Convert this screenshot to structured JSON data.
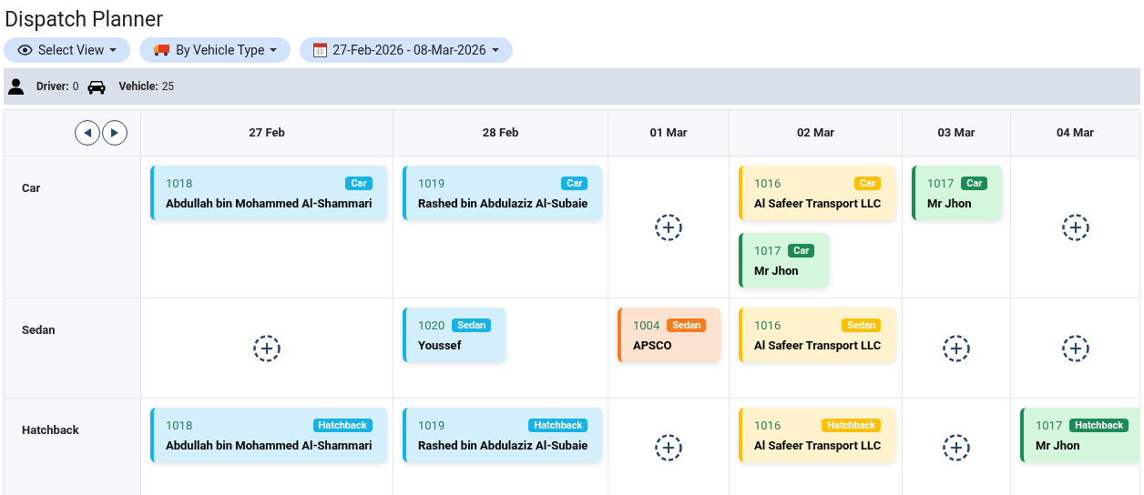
{
  "title": "Dispatch Planner",
  "toolbar": [
    {
      "kind": "view",
      "label": "Select View"
    },
    {
      "kind": "group",
      "label": "By Vehicle Type"
    },
    {
      "kind": "date",
      "label": "27-Feb-2026 - 08-Mar-2026"
    }
  ],
  "summary": [
    {
      "kind": "driver",
      "label": "Driver:",
      "value": "0"
    },
    {
      "kind": "vehicle",
      "label": "Vehicle:",
      "value": "25"
    }
  ],
  "columns": [
    "27 Feb",
    "28 Feb",
    "01 Mar",
    "02 Mar",
    "03 Mar",
    "04 Mar"
  ],
  "rows": [
    {
      "label": "Car",
      "cells": [
        {
          "kind": "cards",
          "cards": [
            {
              "id": "1018",
              "tag": "Car",
              "name": "Abdullah bin Mohammed Al-Shammari",
              "color": "#17b3e6"
            }
          ]
        },
        {
          "kind": "cards",
          "cards": [
            {
              "id": "1019",
              "tag": "Car",
              "name": "Rashed bin Abdulaziz Al-Subaie",
              "color": "#17b3e6"
            }
          ]
        },
        {
          "kind": "empty"
        },
        {
          "kind": "cards",
          "cards": [
            {
              "id": "1016",
              "tag": "Car",
              "name": "Al Safeer Transport LLC",
              "color": "#ffc107"
            },
            {
              "id": "1017",
              "tag": "Car",
              "name": "Mr Jhon",
              "color": "#1e8a55"
            }
          ]
        },
        {
          "kind": "cards",
          "cards": [
            {
              "id": "1017",
              "tag": "Car",
              "name": "Mr Jhon",
              "color": "#1e8a55"
            }
          ]
        },
        {
          "kind": "empty"
        }
      ]
    },
    {
      "label": "Sedan",
      "cells": [
        {
          "kind": "empty"
        },
        {
          "kind": "cards",
          "cards": [
            {
              "id": "1020",
              "tag": "Sedan",
              "name": "Youssef",
              "color": "#17b3e6"
            }
          ]
        },
        {
          "kind": "cards",
          "cards": [
            {
              "id": "1004",
              "tag": "Sedan",
              "name": "APSCO",
              "color": "#f57c1f"
            }
          ]
        },
        {
          "kind": "cards",
          "cards": [
            {
              "id": "1016",
              "tag": "Sedan",
              "name": "Al Safeer Transport LLC",
              "color": "#ffc107"
            }
          ]
        },
        {
          "kind": "empty"
        },
        {
          "kind": "empty"
        }
      ]
    },
    {
      "label": "Hatchback",
      "cells": [
        {
          "kind": "cards",
          "cards": [
            {
              "id": "1018",
              "tag": "Hatchback",
              "name": "Abdullah bin Mohammed Al-Shammari",
              "color": "#17b3e6"
            }
          ]
        },
        {
          "kind": "cards",
          "cards": [
            {
              "id": "1019",
              "tag": "Hatchback",
              "name": "Rashed bin Abdulaziz Al-Subaie",
              "color": "#17b3e6"
            }
          ]
        },
        {
          "kind": "empty"
        },
        {
          "kind": "cards",
          "cards": [
            {
              "id": "1016",
              "tag": "Hatchback",
              "name": "Al Safeer Transport LLC",
              "color": "#ffc107"
            }
          ]
        },
        {
          "kind": "empty"
        },
        {
          "kind": "cards",
          "cards": [
            {
              "id": "1017",
              "tag": "Hatchback",
              "name": "Mr Jhon",
              "color": "#1e8a55"
            }
          ]
        }
      ]
    }
  ]
}
